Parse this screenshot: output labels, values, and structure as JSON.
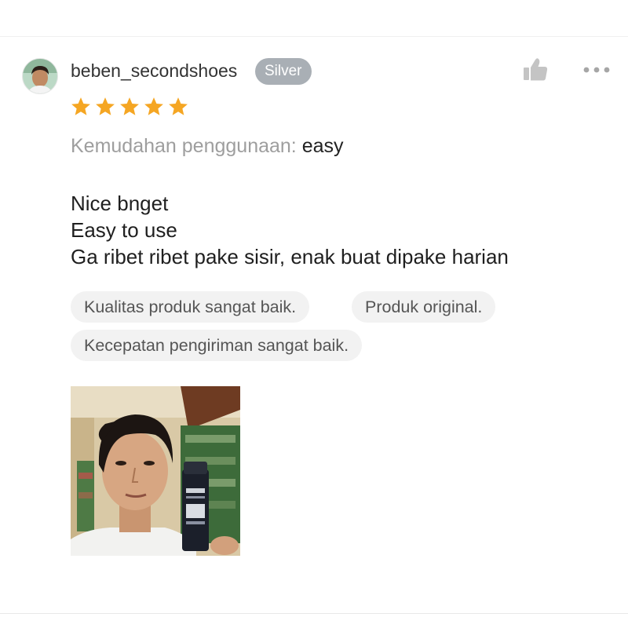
{
  "review": {
    "username": "beben_secondshoes",
    "badge": "Silver",
    "rating": 5,
    "rating_max": 5,
    "attribute_label": "Kemudahan penggunaan:",
    "attribute_value": "easy",
    "body_lines": [
      "Nice bnget",
      "Easy to use",
      "Ga ribet ribet pake sisir, enak buat dipake harian"
    ],
    "tags": [
      "Kualitas produk sangat baik.",
      "Produk original.",
      "Kecepatan pengiriman sangat baik."
    ]
  },
  "icons": {
    "like": "thumbs-up-icon",
    "more": "more-dots-icon",
    "star": "star-icon"
  },
  "colors": {
    "star": "#f5a623",
    "badge_bg": "#a9afb5",
    "chip_bg": "#f2f2f2",
    "muted_text": "#9e9e9e"
  }
}
